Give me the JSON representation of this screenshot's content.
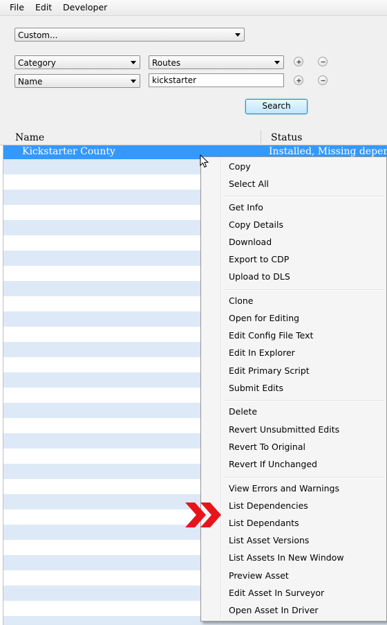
{
  "menubar": {
    "file": "File",
    "edit": "Edit",
    "developer": "Developer"
  },
  "filter": {
    "preset": "Custom...",
    "row1": {
      "field": "Category",
      "value": "Routes"
    },
    "row2": {
      "field": "Name",
      "value": "kickstarter"
    },
    "search_label": "Search"
  },
  "list": {
    "headers": {
      "name": "Name",
      "status": "Status"
    },
    "selected": {
      "name": "Kickstarter County",
      "status": "Installed, Missing dependencies"
    }
  },
  "context_menu": {
    "items": [
      "Copy",
      "Select All",
      "Get Info",
      "Copy Details",
      "Download",
      "Export to CDP",
      "Upload to DLS",
      "Clone",
      "Open for Editing",
      "Edit Config File Text",
      "Edit In Explorer",
      "Edit Primary Script",
      "Submit Edits",
      "Delete",
      "Revert Unsubmitted Edits",
      "Revert To Original",
      "Revert If Unchanged",
      "View Errors and Warnings",
      "List Dependencies",
      "List Dependants",
      "List Asset Versions",
      "List Assets In New Window",
      "Preview Asset",
      "Edit Asset In Surveyor",
      "Open Asset In Driver"
    ]
  },
  "colors": {
    "selection": "#3399ff",
    "alt_row": "#dde9f7",
    "highlight_arrow": "#e8141c"
  }
}
